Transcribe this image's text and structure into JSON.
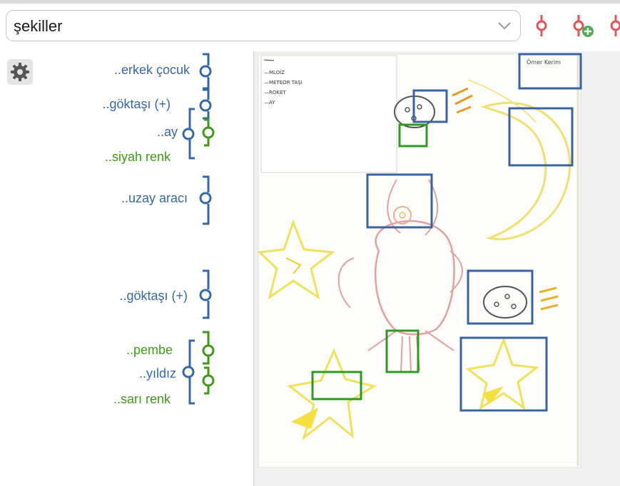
{
  "code_select": {
    "value": "şekiller",
    "chevron_icon": "chevron-down-icon"
  },
  "toolbar": {
    "icons": [
      "code-marker-icon",
      "add-code-marker-icon",
      "code-marker-icon"
    ],
    "accent_color": "#e05555",
    "add_color": "#4caf50"
  },
  "sidebar": {
    "settings_icon": "gear-icon",
    "codes": [
      {
        "label": "..erkek çocuk",
        "color": "blue"
      },
      {
        "label": "..göktaşı (+)",
        "color": "blue"
      },
      {
        "label": "..ay",
        "color": "blue"
      },
      {
        "label": "..siyah renk",
        "color": "green"
      },
      {
        "label": "..uzay aracı",
        "color": "blue"
      },
      {
        "label": "..göktaşı (+)",
        "color": "blue"
      },
      {
        "label": "..pembe",
        "color": "green"
      },
      {
        "label": "..yıldız",
        "color": "blue"
      },
      {
        "label": "..sarı renk",
        "color": "green"
      }
    ],
    "colors": {
      "blue": "#3568a8",
      "green": "#3f9a16"
    }
  },
  "image": {
    "note_lines": [
      "—MLOİZ",
      "—METEOR TAŞI",
      "—ROKET",
      "—AY"
    ],
    "name_tag": "Ömer Kerim",
    "region_colors": {
      "blue": "#3a63a3",
      "green": "#2e9a22"
    }
  }
}
